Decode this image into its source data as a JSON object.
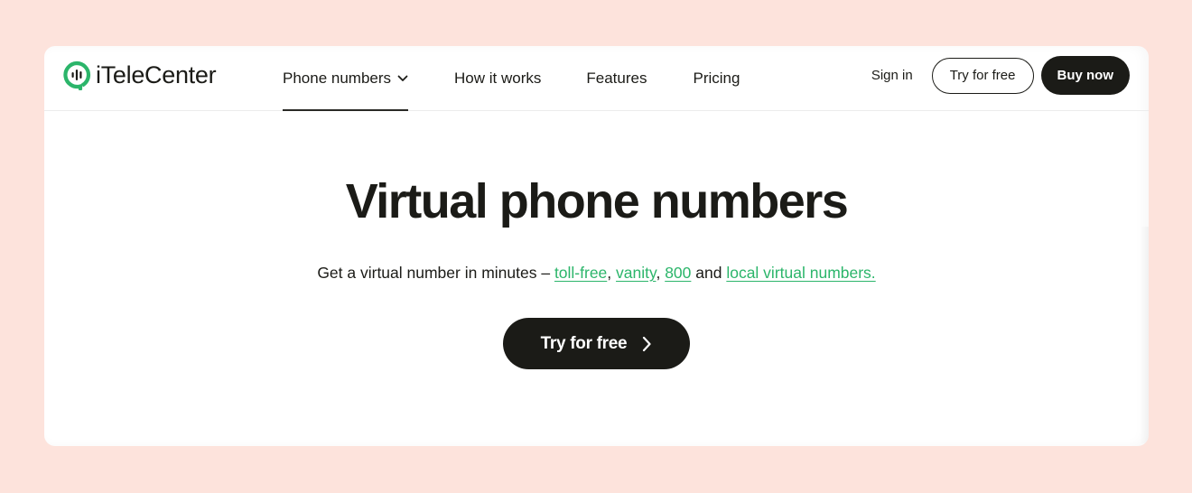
{
  "brand": {
    "name": "iTeleCenter",
    "accent": "#2bb56a",
    "page_bg": "#fde3dc"
  },
  "nav": {
    "items": [
      {
        "label": "Phone numbers",
        "has_dropdown": true,
        "active": true
      },
      {
        "label": "How it works"
      },
      {
        "label": "Features"
      },
      {
        "label": "Pricing"
      }
    ]
  },
  "header_actions": {
    "sign_in": "Sign in",
    "try_free": "Try for free",
    "buy_now": "Buy now"
  },
  "hero": {
    "title": "Virtual phone numbers",
    "subtitle_prefix": "Get a virtual number in minutes – ",
    "links": [
      "toll-free",
      "vanity",
      "800",
      "local virtual numbers."
    ],
    "sep1": ", ",
    "sep2": ", ",
    "sep3": " and ",
    "cta_label": "Try for free"
  }
}
